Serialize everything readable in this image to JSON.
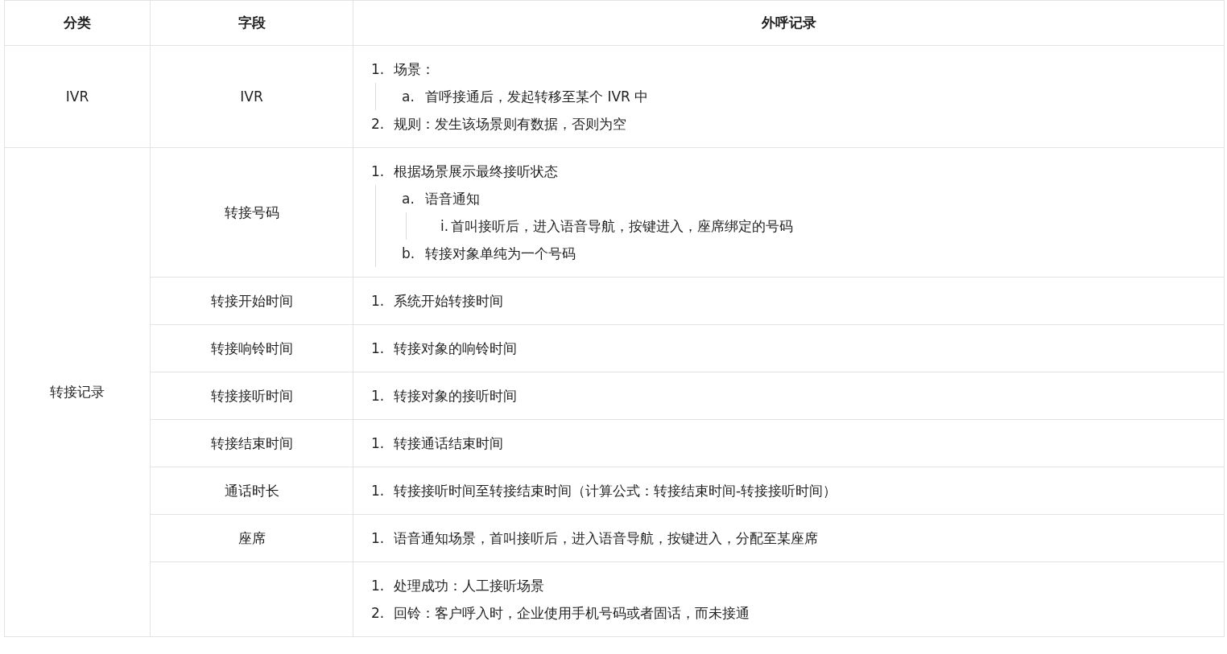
{
  "table": {
    "columns": [
      "分类",
      "字段",
      "外呼记录"
    ],
    "groups": [
      {
        "category": "IVR",
        "rows": [
          {
            "field": "IVR",
            "notes": [
              {
                "marker": "1.",
                "text": "场景：",
                "children": [
                  {
                    "marker": "a.",
                    "text": "首呼接通后，发起转移至某个 IVR 中"
                  }
                ]
              },
              {
                "marker": "2.",
                "text": "规则：发生该场景则有数据，否则为空"
              }
            ]
          }
        ]
      },
      {
        "category": "转接记录",
        "rows": [
          {
            "field": "转接号码",
            "notes": [
              {
                "marker": "1.",
                "text": "根据场景展示最终接听状态",
                "children": [
                  {
                    "marker": "a.",
                    "text": "语音通知",
                    "children": [
                      {
                        "marker": "i.",
                        "text": "首叫接听后，进入语音导航，按键进入，座席绑定的号码"
                      }
                    ]
                  },
                  {
                    "marker": "b.",
                    "text": "转接对象单纯为一个号码"
                  }
                ]
              }
            ]
          },
          {
            "field": "转接开始时间",
            "notes": [
              {
                "marker": "1.",
                "text": "系统开始转接时间"
              }
            ]
          },
          {
            "field": "转接响铃时间",
            "notes": [
              {
                "marker": "1.",
                "text": "转接对象的响铃时间"
              }
            ]
          },
          {
            "field": "转接接听时间",
            "notes": [
              {
                "marker": "1.",
                "text": "转接对象的接听时间"
              }
            ]
          },
          {
            "field": "转接结束时间",
            "notes": [
              {
                "marker": "1.",
                "text": "转接通话结束时间"
              }
            ]
          },
          {
            "field": "通话时长",
            "notes": [
              {
                "marker": "1.",
                "text": "转接接听时间至转接结束时间（计算公式：转接结束时间-转接接听时间）"
              }
            ]
          },
          {
            "field": "座席",
            "notes": [
              {
                "marker": "1.",
                "text": "语音通知场景，首叫接听后，进入语音导航，按键进入，分配至某座席"
              }
            ]
          },
          {
            "notes": [
              {
                "marker": "1.",
                "text": "处理成功：人工接听场景"
              },
              {
                "marker": "2.",
                "text": "回铃：客户呼入时，企业使用手机号码或者固话，而未接通"
              }
            ]
          }
        ]
      }
    ]
  }
}
